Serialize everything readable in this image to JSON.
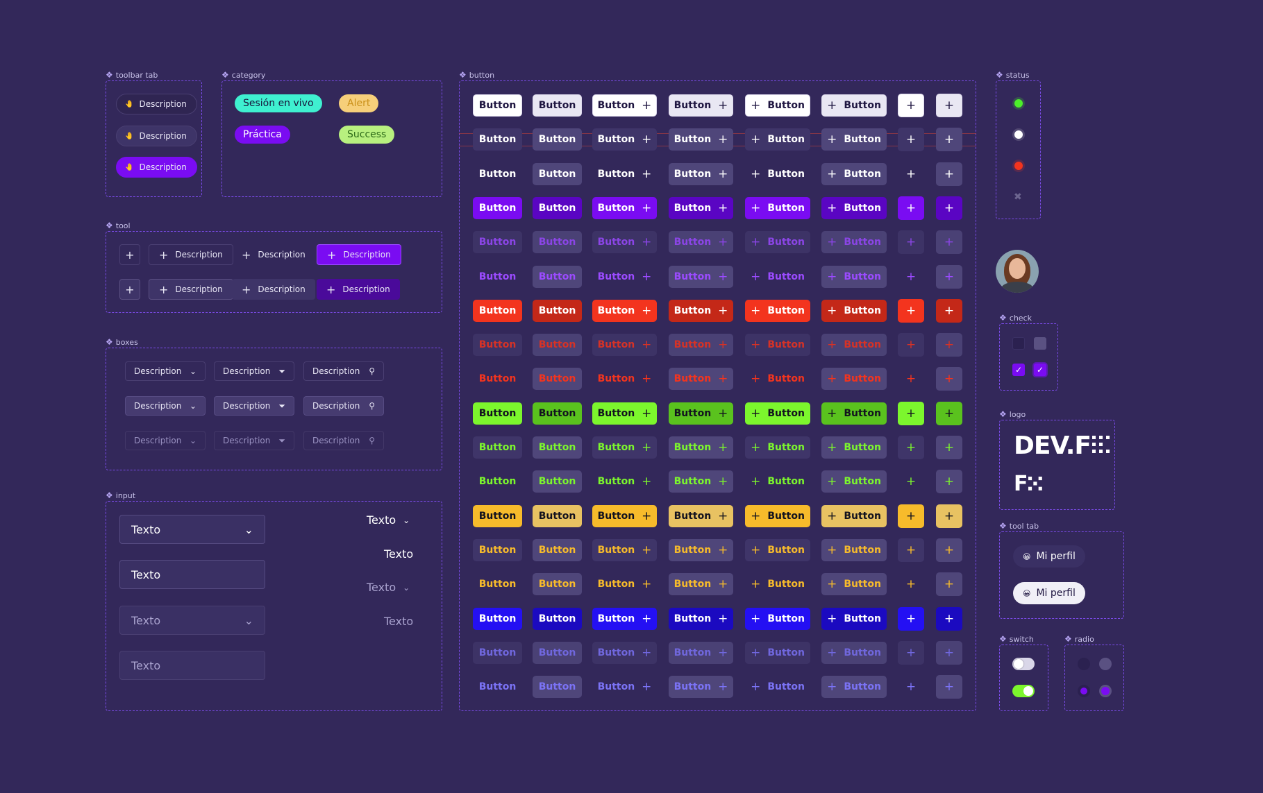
{
  "sections": {
    "toolbar_tab": "toolbar tab",
    "category": "category",
    "button": "button",
    "status": "status",
    "tool": "tool",
    "boxes": "boxes",
    "input": "input",
    "check": "check",
    "logo": "logo",
    "tool_tab": "tool tab",
    "switch": "switch",
    "radio": "radio"
  },
  "toolbar_tabs": [
    "Description",
    "Description",
    "Description"
  ],
  "categories": [
    "Sesión en vivo",
    "Alert",
    "Práctica",
    "Success"
  ],
  "tools": {
    "row1": [
      "Description",
      "Description",
      "Description"
    ],
    "row2": [
      "Description",
      "Description",
      "Description"
    ]
  },
  "boxes": [
    "Description",
    "Description",
    "Description"
  ],
  "inputs": {
    "field": "Texto",
    "text": "Texto"
  },
  "button_label": "Button",
  "logo": {
    "main": "DEV.F",
    "mark": "F"
  },
  "tool_tab": [
    "Mi perfil",
    "Mi perfil"
  ],
  "colors": {
    "background": "#33285a",
    "frame": "#7b4be8",
    "purple": "#7a0cf2",
    "red": "#f3341e",
    "green": "#7cf62d",
    "yellow": "#f7bb2b",
    "blue": "#2410f3"
  }
}
